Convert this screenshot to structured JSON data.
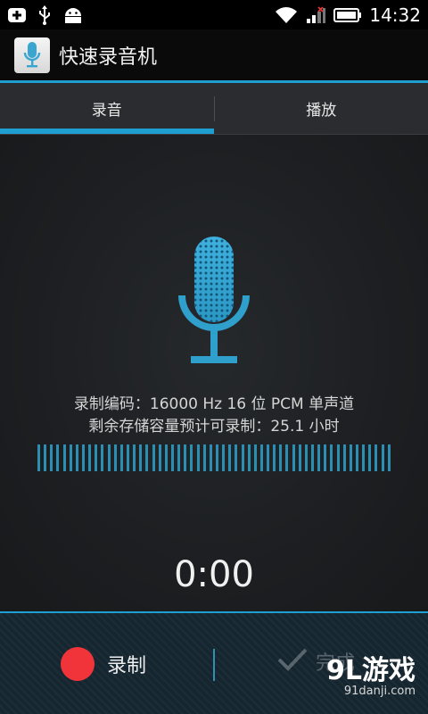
{
  "status_bar": {
    "time": "14:32",
    "icons_left": [
      "add-box-icon",
      "usb-icon",
      "android-icon"
    ],
    "icons_right": [
      "wifi-icon",
      "signal-icon",
      "battery-icon"
    ]
  },
  "action_bar": {
    "title": "快速录音机",
    "app_icon": "microphone-icon"
  },
  "tabs": [
    {
      "label": "录音",
      "active": true
    },
    {
      "label": "播放",
      "active": false
    }
  ],
  "recorder": {
    "encoding_line": "录制编码：16000 Hz 16 位 PCM 单声道",
    "capacity_line": "剩余存储容量预计可录制：25.1 小时",
    "elapsed_time": "0:00"
  },
  "bottom_bar": {
    "record_label": "录制",
    "done_label": "完成"
  },
  "watermark": {
    "logo_text": "9L游戏",
    "site": "91danji.com"
  },
  "colors": {
    "accent": "#1f9fd1",
    "record_red": "#f0343a",
    "background": "#1b1d20"
  }
}
